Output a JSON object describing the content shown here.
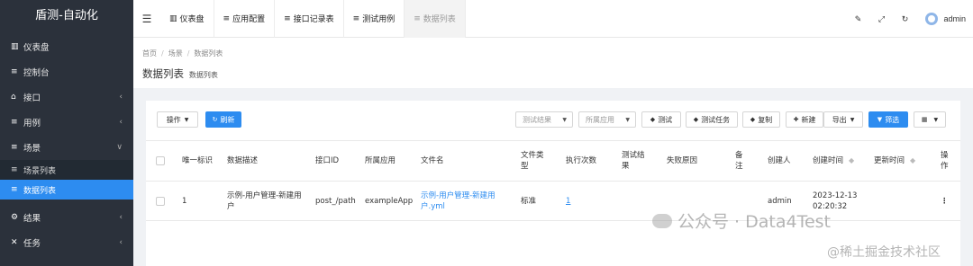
{
  "brand": "盾测-自动化",
  "sidebar": {
    "items": [
      {
        "icon": "bar-chart-icon",
        "glyph": "▥",
        "label": "仪表盘"
      },
      {
        "icon": "list-icon",
        "glyph": "≡",
        "label": "控制台"
      },
      {
        "icon": "bank-icon",
        "glyph": "⌂",
        "label": "接口",
        "chevron": "‹"
      },
      {
        "icon": "list-icon",
        "glyph": "≡",
        "label": "用例",
        "chevron": "‹"
      },
      {
        "icon": "list-icon",
        "glyph": "≡",
        "label": "场景",
        "chevron": "∨"
      }
    ],
    "sub_items": [
      {
        "glyph": "≡",
        "label": "场景列表"
      },
      {
        "glyph": "≡",
        "label": "数据列表"
      }
    ],
    "bottom_items": [
      {
        "icon": "cubes-icon",
        "glyph": "⚙",
        "label": "结果",
        "chevron": "‹"
      },
      {
        "icon": "expand-icon",
        "glyph": "✕",
        "label": "任务",
        "chevron": "‹"
      }
    ]
  },
  "topbar": {
    "tabs": [
      {
        "glyph": "▥",
        "label": "仪表盘"
      },
      {
        "glyph": "≡",
        "label": "应用配置"
      },
      {
        "glyph": "≡",
        "label": "接口记录表"
      },
      {
        "glyph": "≡",
        "label": "测试用例"
      },
      {
        "glyph": "≡",
        "label": "数据列表"
      }
    ],
    "user": "admin"
  },
  "breadcrumb": [
    "首页",
    "场景",
    "数据列表"
  ],
  "page": {
    "title": "数据列表",
    "subtitle": "数据列表"
  },
  "toolbar": {
    "actions_label": "操作",
    "refresh_label": "刷新",
    "filter_result_placeholder": "测试结果",
    "filter_app_placeholder": "所属应用",
    "test_label": "测试",
    "test_task_label": "测试任务",
    "copy_label": "复制",
    "new_label": "新建",
    "export_label": "导出",
    "filter_label": "筛选"
  },
  "table": {
    "headers": [
      "唯一标识",
      "数据描述",
      "接口ID",
      "所属应用",
      "文件名",
      "文件类型",
      "执行次数",
      "测试结果",
      "失败原因",
      "备注",
      "创建人",
      "创建时间",
      "更新时间",
      "操作"
    ],
    "rows": [
      {
        "id": "1",
        "desc": "示例-用户管理-新建用户",
        "api_id": "post_/path",
        "app": "exampleApp",
        "file": "示例-用户管理-新建用户.yml",
        "file_type": "标准",
        "exec_count": "1",
        "result": "",
        "reason": "",
        "note": "",
        "creator": "admin",
        "created": "2023-12-13 02:20:32",
        "updated": "",
        "ops": "⋮"
      }
    ]
  },
  "watermark": {
    "line1": "公众号 · Data4Test",
    "line2": "@稀土掘金技术社区"
  }
}
